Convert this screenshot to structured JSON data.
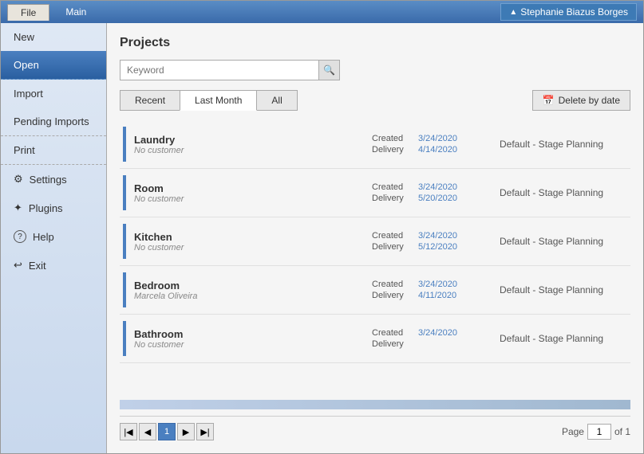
{
  "titlebar": {
    "file_tab": "File",
    "main_tab": "Main",
    "user_name": "Stephanie Biazus Borges",
    "chevron": "▲"
  },
  "sidebar": {
    "items": [
      {
        "id": "new",
        "label": "New",
        "icon": "",
        "active": false,
        "border_bottom": false
      },
      {
        "id": "open",
        "label": "Open",
        "icon": "",
        "active": true,
        "border_bottom": true
      },
      {
        "id": "import",
        "label": "Import",
        "icon": "",
        "active": false,
        "border_bottom": false
      },
      {
        "id": "pending-imports",
        "label": "Pending Imports",
        "icon": "",
        "active": false,
        "border_bottom": true
      },
      {
        "id": "print",
        "label": "Print",
        "icon": "",
        "active": false,
        "border_bottom": true
      },
      {
        "id": "settings",
        "label": "Settings",
        "icon": "⚙",
        "active": false,
        "border_bottom": false
      },
      {
        "id": "plugins",
        "label": "Plugins",
        "icon": "✦",
        "active": false,
        "border_bottom": false
      },
      {
        "id": "help",
        "label": "Help",
        "icon": "?",
        "active": false,
        "border_bottom": false
      },
      {
        "id": "exit",
        "label": "Exit",
        "icon": "⎋",
        "active": false,
        "border_bottom": false
      }
    ]
  },
  "content": {
    "title": "Projects",
    "search": {
      "placeholder": "Keyword",
      "value": ""
    },
    "tabs": [
      {
        "id": "recent",
        "label": "Recent",
        "active": false
      },
      {
        "id": "last-month",
        "label": "Last Month",
        "active": true
      },
      {
        "id": "all",
        "label": "All",
        "active": false
      }
    ],
    "delete_by_date_label": "Delete by date",
    "projects": [
      {
        "name": "Laundry",
        "customer": "No customer",
        "created_label": "Created",
        "created_date": "3/24/2020",
        "delivery_label": "Delivery",
        "delivery_date": "4/14/2020",
        "stage": "Default - Stage Planning"
      },
      {
        "name": "Room",
        "customer": "No customer",
        "created_label": "Created",
        "created_date": "3/24/2020",
        "delivery_label": "Delivery",
        "delivery_date": "5/20/2020",
        "stage": "Default - Stage Planning"
      },
      {
        "name": "Kitchen",
        "customer": "No customer",
        "created_label": "Created",
        "created_date": "3/24/2020",
        "delivery_label": "Delivery",
        "delivery_date": "5/12/2020",
        "stage": "Default - Stage Planning"
      },
      {
        "name": "Bedroom",
        "customer": "Marcela Oliveira",
        "created_label": "Created",
        "created_date": "3/24/2020",
        "delivery_label": "Delivery",
        "delivery_date": "4/11/2020",
        "stage": "Default - Stage Planning"
      },
      {
        "name": "Bathroom",
        "customer": "No customer",
        "created_label": "Created",
        "created_date": "3/24/2020",
        "delivery_label": "Delivery",
        "delivery_date": "",
        "stage": "Default - Stage Planning"
      }
    ],
    "pagination": {
      "page_label": "Page",
      "page_current": "1",
      "page_of": "of 1"
    }
  }
}
